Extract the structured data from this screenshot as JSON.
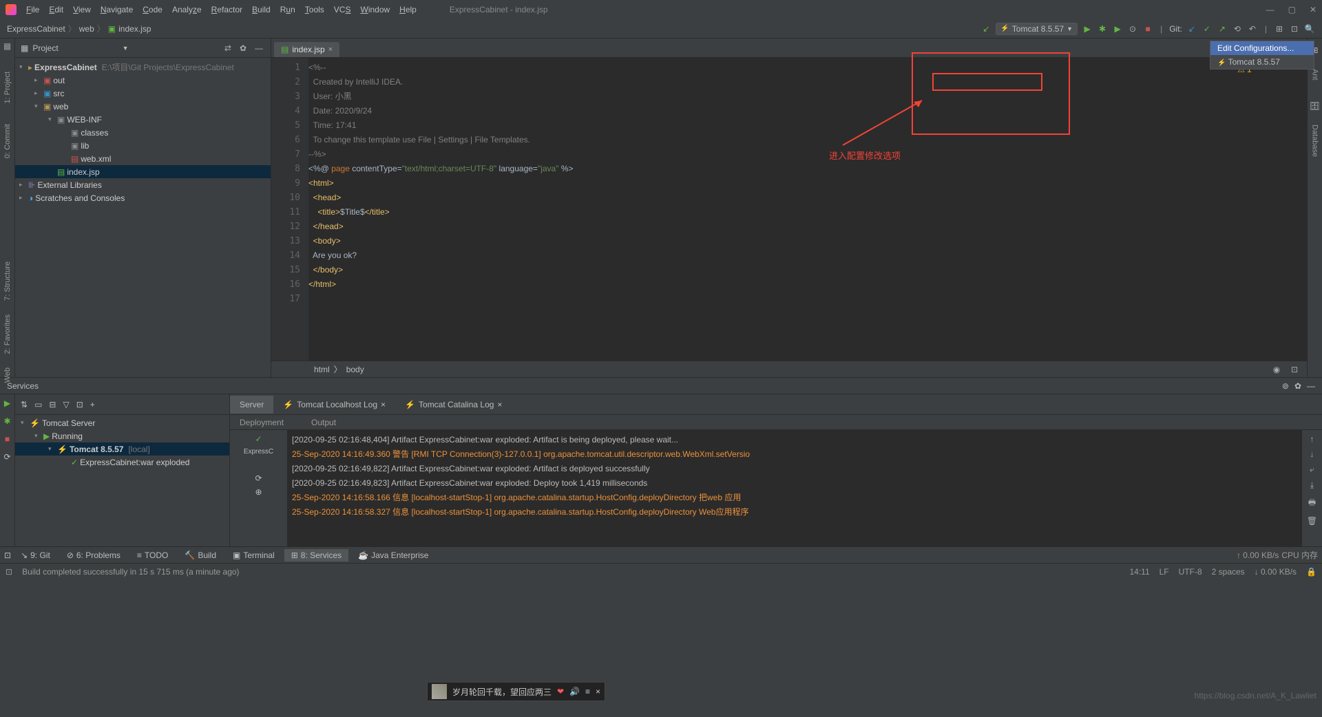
{
  "menu": [
    "File",
    "Edit",
    "View",
    "Navigate",
    "Code",
    "Analyze",
    "Refactor",
    "Build",
    "Run",
    "Tools",
    "VCS",
    "Window",
    "Help"
  ],
  "window_title": "ExpressCabinet - index.jsp",
  "breadcrumbs": [
    "ExpressCabinet",
    "web",
    "index.jsp"
  ],
  "run_config": "Tomcat 8.5.57",
  "git_label": "Git:",
  "dropdown": {
    "edit": "Edit Configurations...",
    "item": "Tomcat 8.5.57"
  },
  "project": {
    "title": "Project",
    "root": {
      "name": "ExpressCabinet",
      "path": "E:\\项目\\Git Projects\\ExpressCabinet"
    },
    "children": [
      "out",
      "src",
      "web"
    ],
    "web_inf": "WEB-INF",
    "webinf_children": [
      "classes",
      "lib",
      "web.xml"
    ],
    "index_jsp": "index.jsp",
    "ext_lib": "External Libraries",
    "scratches": "Scratches and Consoles"
  },
  "tab": "index.jsp",
  "warn_count": "1",
  "code_lines": [
    "<%--",
    "  Created by IntelliJ IDEA.",
    "  User: 小黑",
    "  Date: 2020/9/24",
    "  Time: 17:41",
    "  To change this template use File | Settings | File Templates.",
    "--%>"
  ],
  "page_dir": {
    "pre": "<%@ ",
    "kw": "page",
    "mid": " contentType=",
    "s1": "\"text/html;charset=UTF-8\"",
    "mid2": " language=",
    "s2": "\"java\"",
    "end": " %>"
  },
  "html_lines": {
    "html_open": "<html>",
    "head_open": "<head>",
    "title": "<title>",
    "title_text": "$Title$",
    "title_close": "</title>",
    "head_close": "</head>",
    "body_open": "<body>",
    "body_text": "Are you ok?",
    "body_close": "</body>",
    "html_close": "</html>"
  },
  "crumbs": [
    "html",
    "body"
  ],
  "annot_text": "进入配置修改选项",
  "services": {
    "title": "Services",
    "tabs": [
      "Server",
      "Tomcat Localhost Log",
      "Tomcat Catalina Log"
    ],
    "subhdr": [
      "Deployment",
      "Output"
    ],
    "tree_root": "Tomcat Server",
    "running": "Running",
    "server": "Tomcat 8.5.57",
    "server_suffix": "[local]",
    "artifact": "ExpressCabinet:war exploded",
    "artifact_short": "ExpressC",
    "logs": [
      {
        "c": "wh",
        "t": "[2020-09-25 02:16:48,404] Artifact ExpressCabinet:war exploded: Artifact is being deployed, please wait..."
      },
      {
        "c": "og",
        "t": "25-Sep-2020 14:16:49.360 警告 [RMI TCP Connection(3)-127.0.0.1] org.apache.tomcat.util.descriptor.web.WebXml.setVersio"
      },
      {
        "c": "wh",
        "t": "[2020-09-25 02:16:49,822] Artifact ExpressCabinet:war exploded: Artifact is deployed successfully"
      },
      {
        "c": "wh",
        "t": "[2020-09-25 02:16:49,823] Artifact ExpressCabinet:war exploded: Deploy took 1,419 milliseconds"
      },
      {
        "c": "og",
        "t": "25-Sep-2020 14:16:58.166 信息 [localhost-startStop-1] org.apache.catalina.startup.HostConfig.deployDirectory 把web 应用"
      },
      {
        "c": "og",
        "t": "25-Sep-2020 14:16:58.327 信息 [localhost-startStop-1] org.apache.catalina.startup.HostConfig.deployDirectory Web应用程序"
      }
    ]
  },
  "bottom_tabs": [
    "9: Git",
    "6: Problems",
    "TODO",
    "Build",
    "Terminal",
    "8: Services",
    "Java Enterprise"
  ],
  "status": {
    "msg": "Build completed successfully in 15 s 715 ms (a minute ago)",
    "speed": "0.00 KB/s",
    "pos": "14:11",
    "lf": "LF",
    "enc": "UTF-8",
    "indent": "2 spaces",
    "cpu": "CPU  内存",
    "net2": "↓ 0.00 KB/s"
  },
  "media": {
    "text": "岁月轮回千载，望回应两三",
    "close": "×"
  },
  "watermark": "https://blog.csdn.net/A_K_Lawliet"
}
